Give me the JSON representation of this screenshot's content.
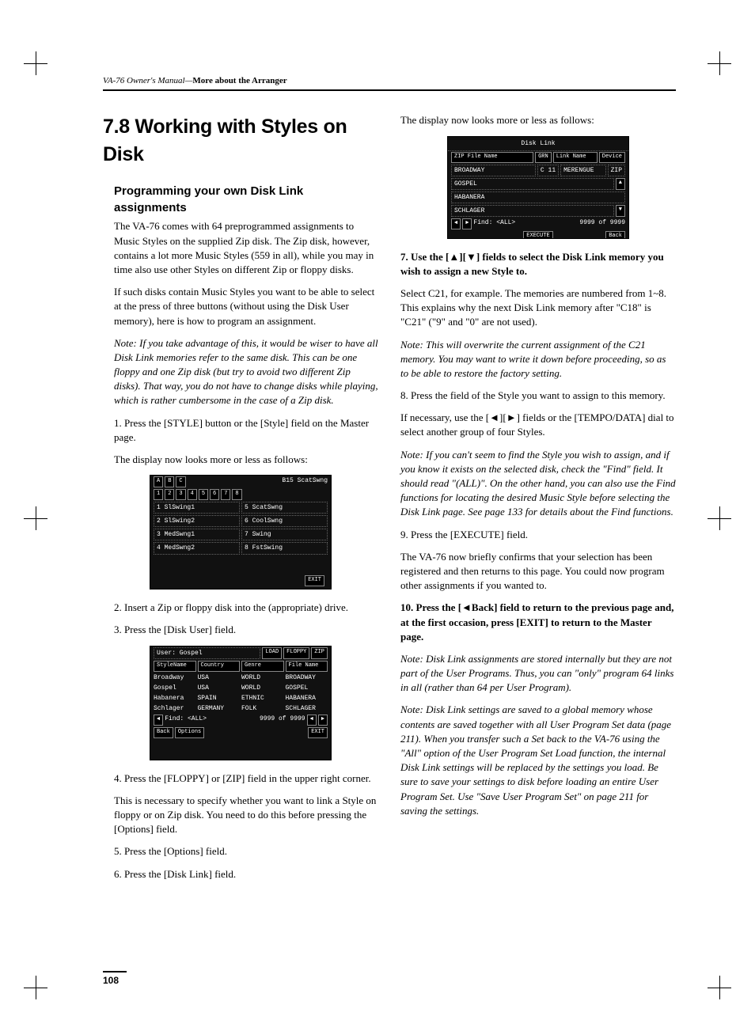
{
  "header": {
    "manual": "VA-76 Owner's Manual",
    "separator": "—",
    "chapter": "More about the Arranger"
  },
  "page_number": "108",
  "left": {
    "h1": "7.8 Working with Styles on Disk",
    "h2": "Programming your own Disk Link assignments",
    "p1": "The VA-76 comes with 64 preprogrammed assignments to Music Styles on the supplied Zip disk. The Zip disk, however, contains a lot more Music Styles (559 in all), while you may in time also use other Styles on different Zip or floppy disks.",
    "p2": "If such disks contain Music Styles you want to be able to select at the press of three buttons (without using the Disk User memory), here is how to program an assignment.",
    "note1": "Note: If you take advantage of this, it would be wiser to have all Disk Link memories refer to the same disk. This can be one floppy and one Zip disk (but try to avoid two different Zip disks). That way, you do not have to change disks while playing, which is rather cumbersome in the case of a Zip disk.",
    "step1": "1. Press the [STYLE] button or the [Style] field on the Master page.",
    "p3": "The display now looks more or less as follows:",
    "step2": "2. Insert a Zip or floppy disk into the (appropriate) drive.",
    "step3": "3. Press the [Disk User] field.",
    "step4": "4. Press the [FLOPPY] or [ZIP] field in the upper right corner.",
    "p4": "This is necessary to specify whether you want to link a Style on floppy or on Zip disk. You need to do this before pressing the [Options] field.",
    "step5": "5. Press the [Options] field.",
    "step6": "6. Press the [Disk Link] field."
  },
  "right": {
    "p1": "The display now looks more or less as follows:",
    "step7a": "7. Use the [",
    "step7b": "][",
    "step7c": "] fields to select the Disk Link memory you wish to assign a new Style to.",
    "p2": "Select C21, for example. The memories are numbered from 1~8. This explains why the next Disk Link memory after \"C18\" is \"C21\" (\"9\" and \"0\" are not used).",
    "note2": "Note: This will overwrite the current assignment of the C21 memory. You may want to write it down before proceeding, so as to be able to restore the factory setting.",
    "step8": "8. Press the field of the Style you want to assign to this memory.",
    "p3a": "If necessary, use the [",
    "p3b": "][",
    "p3c": "] fields or the [TEMPO/DATA] dial to select another group of four Styles.",
    "note3": "Note: If you can't seem to find the Style you wish to assign, and if you know it exists on the selected disk, check the \"Find\" field. It should read \"(ALL)\". On the other hand, you can also use the Find functions for locating the desired Music Style before selecting the Disk Link page. See page 133 for details about the Find functions.",
    "step9": "9. Press the [EXECUTE] field.",
    "p4": "The VA-76 now briefly confirms that your selection has been registered and then returns to this page. You could now program other assignments if you wanted to.",
    "step10a": "10. Press the [",
    "step10b": "Back] field to return to the previous page and, at the first occasion, press [EXIT] to return to the Master page.",
    "note4": "Note: Disk Link assignments are stored internally but they are not part of the User Programs. Thus, you can \"only\" program 64 links in all (rather than 64 per User Program).",
    "note5": "Note: Disk Link settings are saved to a global memory whose contents are saved together with all User Program Set data (page 211). When you transfer such a Set back to the VA-76 using the \"All\" option of the User Program Set Load function, the internal Disk Link settings will be replaced by the settings you load. Be sure to save your settings to disk before loading an entire User Program Set. Use \"Save User Program Set\" on page 211 for saving the settings."
  },
  "screens": {
    "s1": {
      "title": "B15 ScatSwng",
      "rows": [
        [
          "1 SlSwing1",
          "5 ScatSwng"
        ],
        [
          "2 SlSwing2",
          "6 CoolSwng"
        ],
        [
          "3 MedSwng1",
          "7 Swing"
        ],
        [
          "4 MedSwng2",
          "8 FstSwing"
        ]
      ]
    },
    "s2": {
      "user": "User: Gospel",
      "buttons": [
        "LOAD",
        "FLOPPY",
        "ZIP"
      ],
      "headers": [
        "StyleName",
        "Country",
        "Genre",
        "File Name"
      ],
      "rows": [
        [
          "Broadway",
          "USA",
          "WORLD",
          "BROADWAY"
        ],
        [
          "Gospel",
          "USA",
          "WORLD",
          "GOSPEL"
        ],
        [
          "Habanera",
          "SPAIN",
          "ETHNIC",
          "HABANERA"
        ],
        [
          "Schlager",
          "GERMANY",
          "FOLK",
          "SCHLAGER"
        ]
      ],
      "find": "Find: <ALL>",
      "count": "9999 of 9999",
      "options": "Options"
    },
    "s3": {
      "title": "Disk Link",
      "headers": [
        "ZIP File Name",
        "GRN",
        "Link Name",
        "Device"
      ],
      "rows": [
        [
          "BROADWAY",
          "C 11",
          "MERENGUE",
          "ZIP"
        ],
        [
          "GOSPEL",
          "",
          "",
          ""
        ],
        [
          "HABANERA",
          "",
          "",
          ""
        ],
        [
          "SCHLAGER",
          "",
          "",
          ""
        ]
      ],
      "find": "Find: <ALL>",
      "count": "9999 of 9999",
      "execute": "EXECUTE"
    }
  }
}
